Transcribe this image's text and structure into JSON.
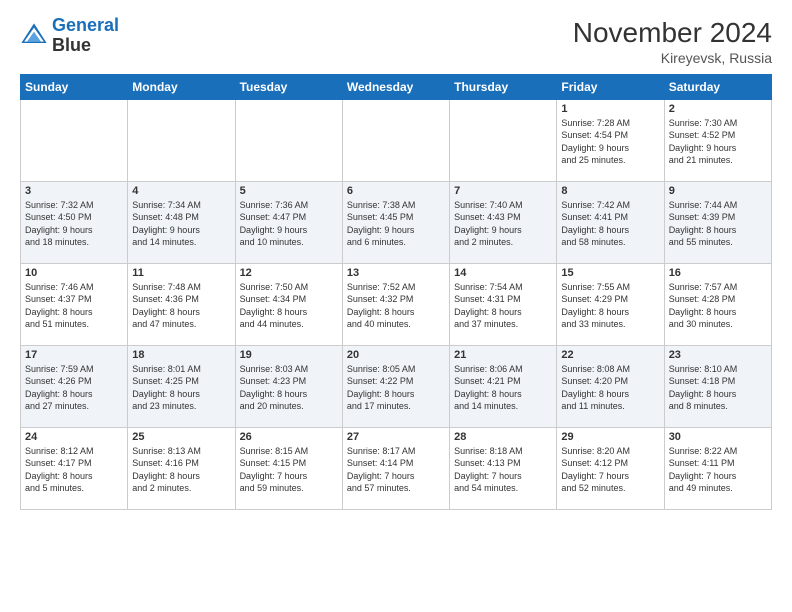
{
  "logo": {
    "line1": "General",
    "line2": "Blue"
  },
  "title": "November 2024",
  "subtitle": "Kireyevsk, Russia",
  "days_of_week": [
    "Sunday",
    "Monday",
    "Tuesday",
    "Wednesday",
    "Thursday",
    "Friday",
    "Saturday"
  ],
  "weeks": [
    [
      {
        "day": "",
        "info": ""
      },
      {
        "day": "",
        "info": ""
      },
      {
        "day": "",
        "info": ""
      },
      {
        "day": "",
        "info": ""
      },
      {
        "day": "",
        "info": ""
      },
      {
        "day": "1",
        "info": "Sunrise: 7:28 AM\nSunset: 4:54 PM\nDaylight: 9 hours\nand 25 minutes."
      },
      {
        "day": "2",
        "info": "Sunrise: 7:30 AM\nSunset: 4:52 PM\nDaylight: 9 hours\nand 21 minutes."
      }
    ],
    [
      {
        "day": "3",
        "info": "Sunrise: 7:32 AM\nSunset: 4:50 PM\nDaylight: 9 hours\nand 18 minutes."
      },
      {
        "day": "4",
        "info": "Sunrise: 7:34 AM\nSunset: 4:48 PM\nDaylight: 9 hours\nand 14 minutes."
      },
      {
        "day": "5",
        "info": "Sunrise: 7:36 AM\nSunset: 4:47 PM\nDaylight: 9 hours\nand 10 minutes."
      },
      {
        "day": "6",
        "info": "Sunrise: 7:38 AM\nSunset: 4:45 PM\nDaylight: 9 hours\nand 6 minutes."
      },
      {
        "day": "7",
        "info": "Sunrise: 7:40 AM\nSunset: 4:43 PM\nDaylight: 9 hours\nand 2 minutes."
      },
      {
        "day": "8",
        "info": "Sunrise: 7:42 AM\nSunset: 4:41 PM\nDaylight: 8 hours\nand 58 minutes."
      },
      {
        "day": "9",
        "info": "Sunrise: 7:44 AM\nSunset: 4:39 PM\nDaylight: 8 hours\nand 55 minutes."
      }
    ],
    [
      {
        "day": "10",
        "info": "Sunrise: 7:46 AM\nSunset: 4:37 PM\nDaylight: 8 hours\nand 51 minutes."
      },
      {
        "day": "11",
        "info": "Sunrise: 7:48 AM\nSunset: 4:36 PM\nDaylight: 8 hours\nand 47 minutes."
      },
      {
        "day": "12",
        "info": "Sunrise: 7:50 AM\nSunset: 4:34 PM\nDaylight: 8 hours\nand 44 minutes."
      },
      {
        "day": "13",
        "info": "Sunrise: 7:52 AM\nSunset: 4:32 PM\nDaylight: 8 hours\nand 40 minutes."
      },
      {
        "day": "14",
        "info": "Sunrise: 7:54 AM\nSunset: 4:31 PM\nDaylight: 8 hours\nand 37 minutes."
      },
      {
        "day": "15",
        "info": "Sunrise: 7:55 AM\nSunset: 4:29 PM\nDaylight: 8 hours\nand 33 minutes."
      },
      {
        "day": "16",
        "info": "Sunrise: 7:57 AM\nSunset: 4:28 PM\nDaylight: 8 hours\nand 30 minutes."
      }
    ],
    [
      {
        "day": "17",
        "info": "Sunrise: 7:59 AM\nSunset: 4:26 PM\nDaylight: 8 hours\nand 27 minutes."
      },
      {
        "day": "18",
        "info": "Sunrise: 8:01 AM\nSunset: 4:25 PM\nDaylight: 8 hours\nand 23 minutes."
      },
      {
        "day": "19",
        "info": "Sunrise: 8:03 AM\nSunset: 4:23 PM\nDaylight: 8 hours\nand 20 minutes."
      },
      {
        "day": "20",
        "info": "Sunrise: 8:05 AM\nSunset: 4:22 PM\nDaylight: 8 hours\nand 17 minutes."
      },
      {
        "day": "21",
        "info": "Sunrise: 8:06 AM\nSunset: 4:21 PM\nDaylight: 8 hours\nand 14 minutes."
      },
      {
        "day": "22",
        "info": "Sunrise: 8:08 AM\nSunset: 4:20 PM\nDaylight: 8 hours\nand 11 minutes."
      },
      {
        "day": "23",
        "info": "Sunrise: 8:10 AM\nSunset: 4:18 PM\nDaylight: 8 hours\nand 8 minutes."
      }
    ],
    [
      {
        "day": "24",
        "info": "Sunrise: 8:12 AM\nSunset: 4:17 PM\nDaylight: 8 hours\nand 5 minutes."
      },
      {
        "day": "25",
        "info": "Sunrise: 8:13 AM\nSunset: 4:16 PM\nDaylight: 8 hours\nand 2 minutes."
      },
      {
        "day": "26",
        "info": "Sunrise: 8:15 AM\nSunset: 4:15 PM\nDaylight: 7 hours\nand 59 minutes."
      },
      {
        "day": "27",
        "info": "Sunrise: 8:17 AM\nSunset: 4:14 PM\nDaylight: 7 hours\nand 57 minutes."
      },
      {
        "day": "28",
        "info": "Sunrise: 8:18 AM\nSunset: 4:13 PM\nDaylight: 7 hours\nand 54 minutes."
      },
      {
        "day": "29",
        "info": "Sunrise: 8:20 AM\nSunset: 4:12 PM\nDaylight: 7 hours\nand 52 minutes."
      },
      {
        "day": "30",
        "info": "Sunrise: 8:22 AM\nSunset: 4:11 PM\nDaylight: 7 hours\nand 49 minutes."
      }
    ]
  ]
}
